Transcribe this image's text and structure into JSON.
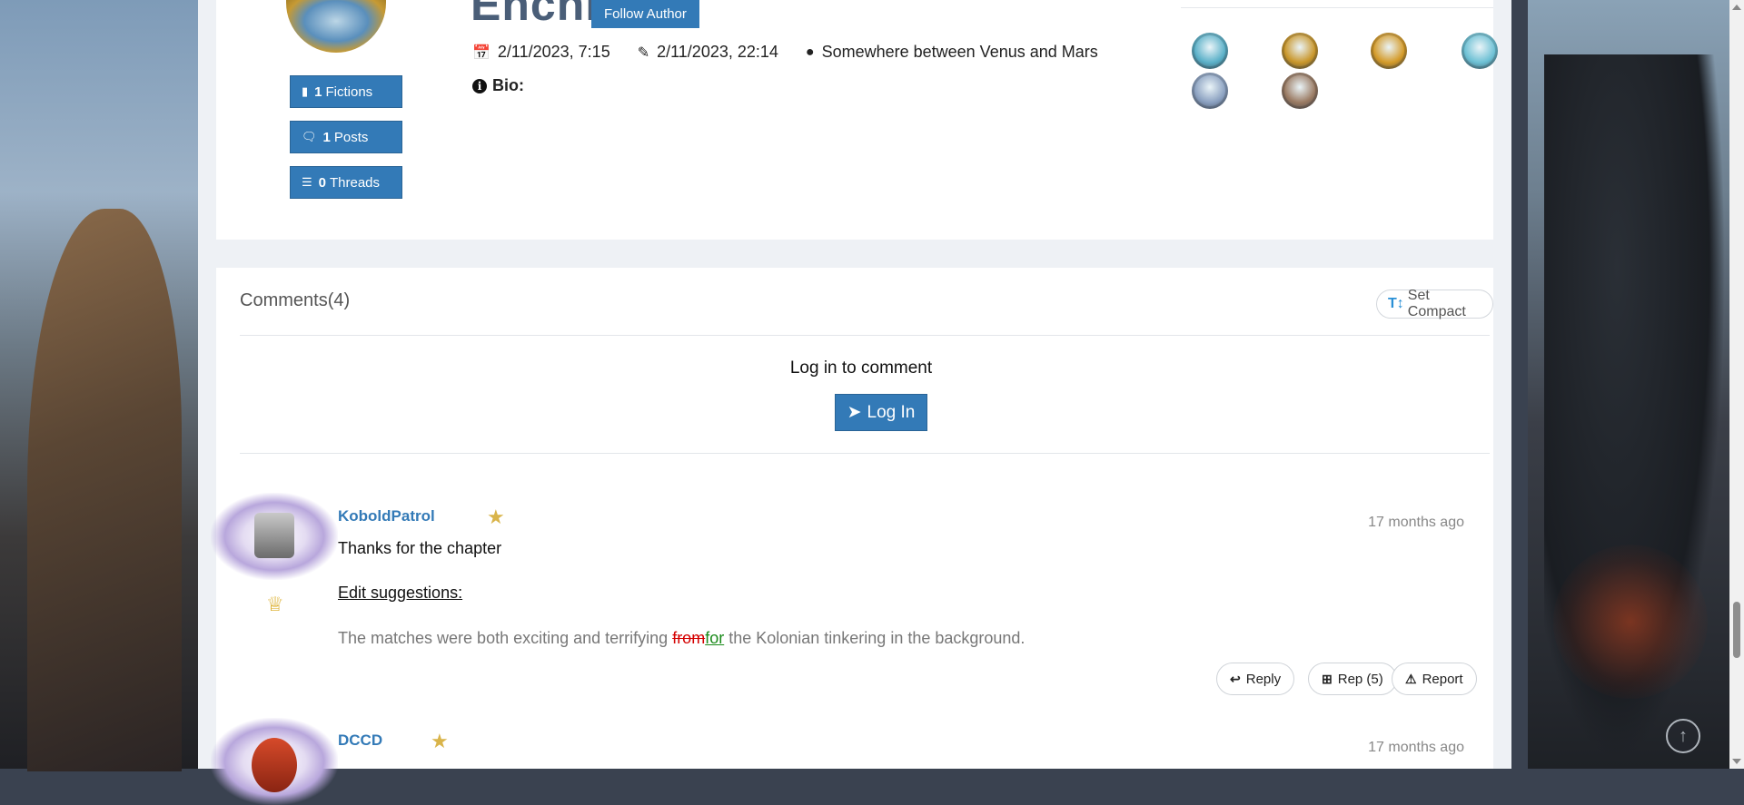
{
  "author": {
    "name": "Enchi",
    "follow_label": "Follow Author",
    "joined": "2/11/2023, 7:15",
    "last_active": "2/11/2023, 22:14",
    "location": "Somewhere between Venus and Mars",
    "bio_label": "Bio:",
    "stats": [
      {
        "count": "1",
        "label": "Fictions",
        "icon": "book-icon"
      },
      {
        "count": "1",
        "label": "Posts",
        "icon": "comment-icon"
      },
      {
        "count": "0",
        "label": "Threads",
        "icon": "list-icon"
      }
    ],
    "badges": [
      {
        "name": "achievement-badge-1",
        "color": "#5ab0c8"
      },
      {
        "name": "achievement-badge-2",
        "color": "#c9962a"
      },
      {
        "name": "achievement-badge-3",
        "color": "#d49a28"
      },
      {
        "name": "achievement-badge-4",
        "color": "#6cc0d4"
      },
      {
        "name": "achievement-badge-5",
        "color": "#8aa0c0"
      },
      {
        "name": "achievement-badge-6",
        "color": "#9a7a62"
      }
    ]
  },
  "comments": {
    "title": "Comments(4)",
    "compact_label": "Set Compact",
    "login_prompt": "Log in to comment",
    "login_label": "Log In",
    "items": [
      {
        "username": "KoboldPatrol",
        "time": "17 months ago",
        "text": "Thanks for the chapter",
        "edit_heading": "Edit suggestions:",
        "suggestion_before": "The matches were both exciting and terrifying ",
        "suggestion_deleted": "from",
        "suggestion_inserted": "for",
        "suggestion_after": " the Kolonian tinkering in the background.",
        "reply_label": "Reply",
        "rep_label": "Rep (5)",
        "report_label": "Report"
      },
      {
        "username": "DCCD",
        "time": "17 months ago"
      }
    ]
  },
  "colors": {
    "primary": "#337ab7",
    "link": "#337ab7",
    "star": "#d9b44a",
    "deleted": "#d40000",
    "inserted": "#1a8a1a"
  }
}
